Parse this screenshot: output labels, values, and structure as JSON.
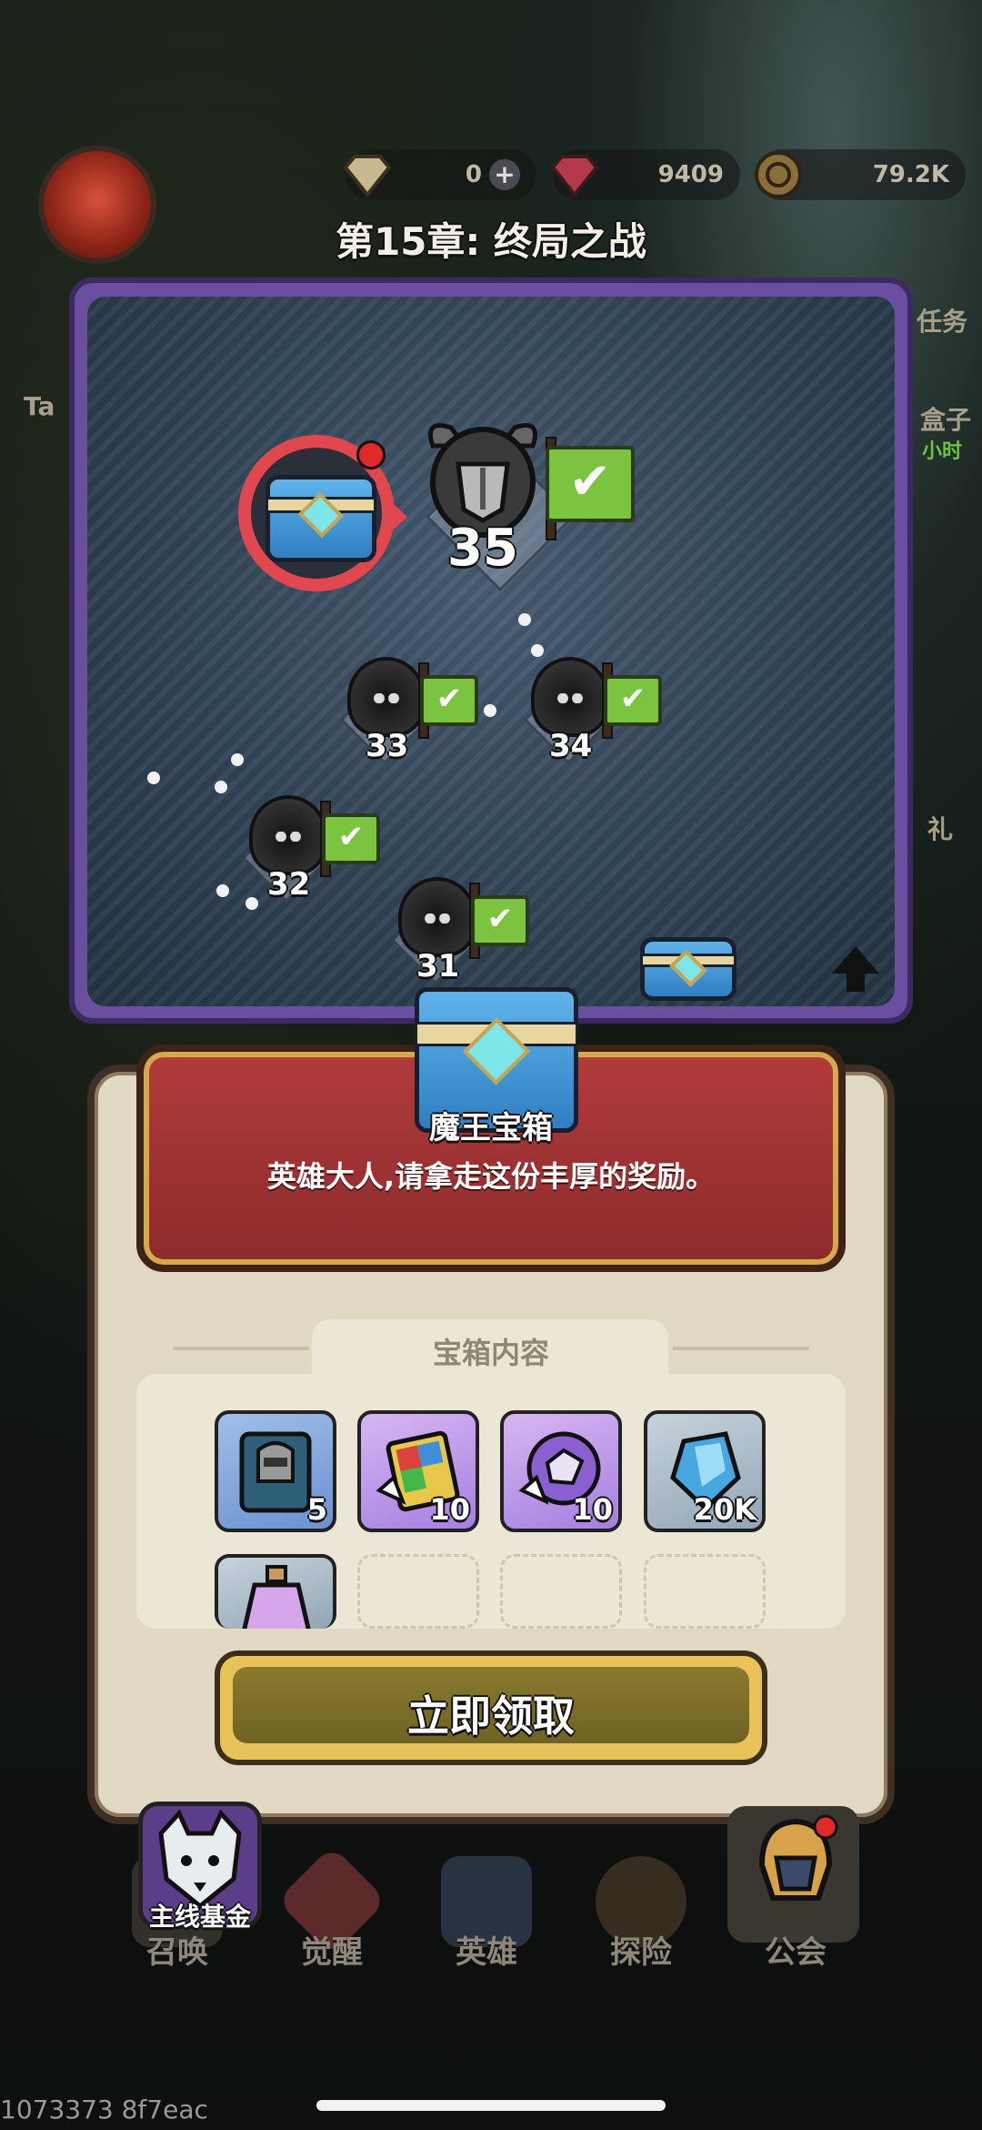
{
  "header": {
    "resources": [
      {
        "name": "gem",
        "value": "0",
        "has_plus": true
      },
      {
        "name": "ruby",
        "value": "9409"
      },
      {
        "name": "gold-coin",
        "value": "79.2K"
      }
    ],
    "chapter_title": "第15章: 终局之战"
  },
  "side": {
    "left_tab": "Ta",
    "right_task": "任务",
    "right_box": "盒子",
    "right_timer": "小时",
    "right_gift": "礼"
  },
  "map": {
    "stages": [
      {
        "label": "35",
        "cleared": true,
        "boss": true
      },
      {
        "label": "34",
        "cleared": true
      },
      {
        "label": "33",
        "cleared": true
      },
      {
        "label": "32",
        "cleared": true
      },
      {
        "label": "31",
        "cleared": true
      }
    ]
  },
  "reward": {
    "title": "魔王宝箱",
    "description": "英雄大人,请拿走这份丰厚的奖励。",
    "section_label": "宝箱内容",
    "items": [
      {
        "icon": "hero-book-icon",
        "qty": "5"
      },
      {
        "icon": "skill-book-icon",
        "qty": "10"
      },
      {
        "icon": "orb-scroll-icon",
        "qty": "10"
      },
      {
        "icon": "crystal-icon",
        "qty": "20K"
      },
      {
        "icon": "potion-icon",
        "qty": ""
      }
    ],
    "claim_label": "立即领取"
  },
  "nav": {
    "fund_label": "主线基金",
    "items": [
      {
        "label": "召唤"
      },
      {
        "label": "觉醒"
      },
      {
        "label": "英雄"
      },
      {
        "label": "探险"
      },
      {
        "label": "公会"
      }
    ]
  },
  "footer": {
    "build_id": "1073373 8f7eac"
  },
  "colors": {
    "banner_red": "#9e3232",
    "claim_gold": "#e9c25a",
    "flag_green": "#7cc43f",
    "map_purple": "#6a4fa0"
  }
}
